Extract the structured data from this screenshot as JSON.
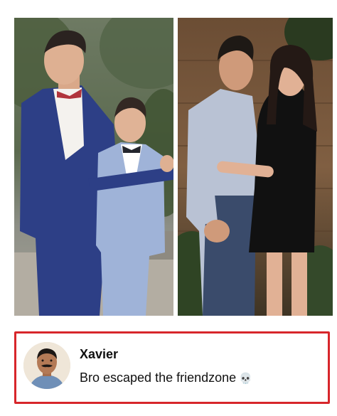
{
  "post": {
    "photos": [
      {
        "icon": "two-boys-in-suits-photo"
      },
      {
        "icon": "couple-evening-photo"
      }
    ]
  },
  "comment": {
    "author": "Xavier",
    "text": "Bro escaped the friendzone",
    "emoji": "💀",
    "avatar_icon": "user-avatar-photo",
    "border_color": "#d7262b"
  }
}
